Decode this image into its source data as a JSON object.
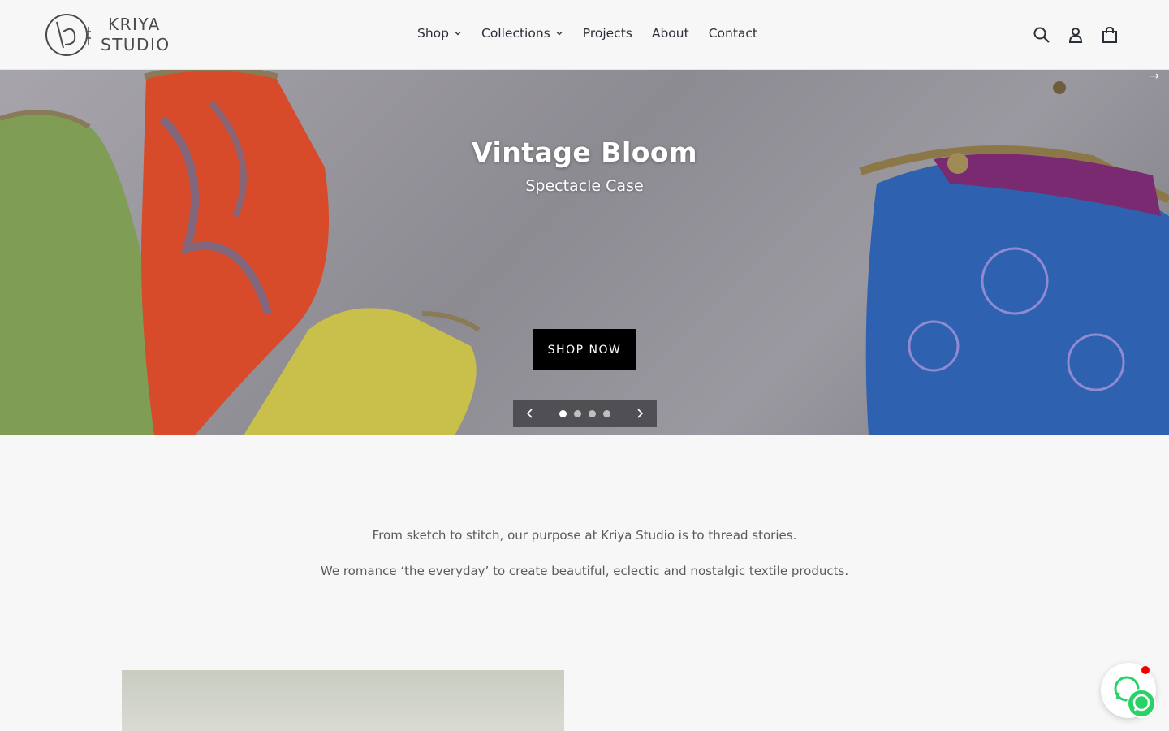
{
  "brand": {
    "line1": "KRIYA",
    "line2": "STUDIO"
  },
  "nav": {
    "items": [
      {
        "label": "Shop",
        "has_dropdown": true
      },
      {
        "label": "Collections",
        "has_dropdown": true
      },
      {
        "label": "Projects",
        "has_dropdown": false
      },
      {
        "label": "About",
        "has_dropdown": false
      },
      {
        "label": "Contact",
        "has_dropdown": false
      }
    ]
  },
  "header_icons": [
    "search-icon",
    "account-icon",
    "cart-icon"
  ],
  "hero": {
    "title": "Vintage Bloom",
    "subtitle": "Spectacle Case",
    "button": "SHOP NOW",
    "slides_total": 4,
    "active_slide": 1
  },
  "intro": {
    "line1": "From sketch to stitch, our purpose at Kriya Studio is to thread stories.",
    "line2": "We romance ‘the everyday’ to create beautiful, eclectic and nostalgic textile products."
  },
  "colors": {
    "accent": "#000000",
    "whatsapp": "#25d366",
    "notification": "#e00000"
  }
}
